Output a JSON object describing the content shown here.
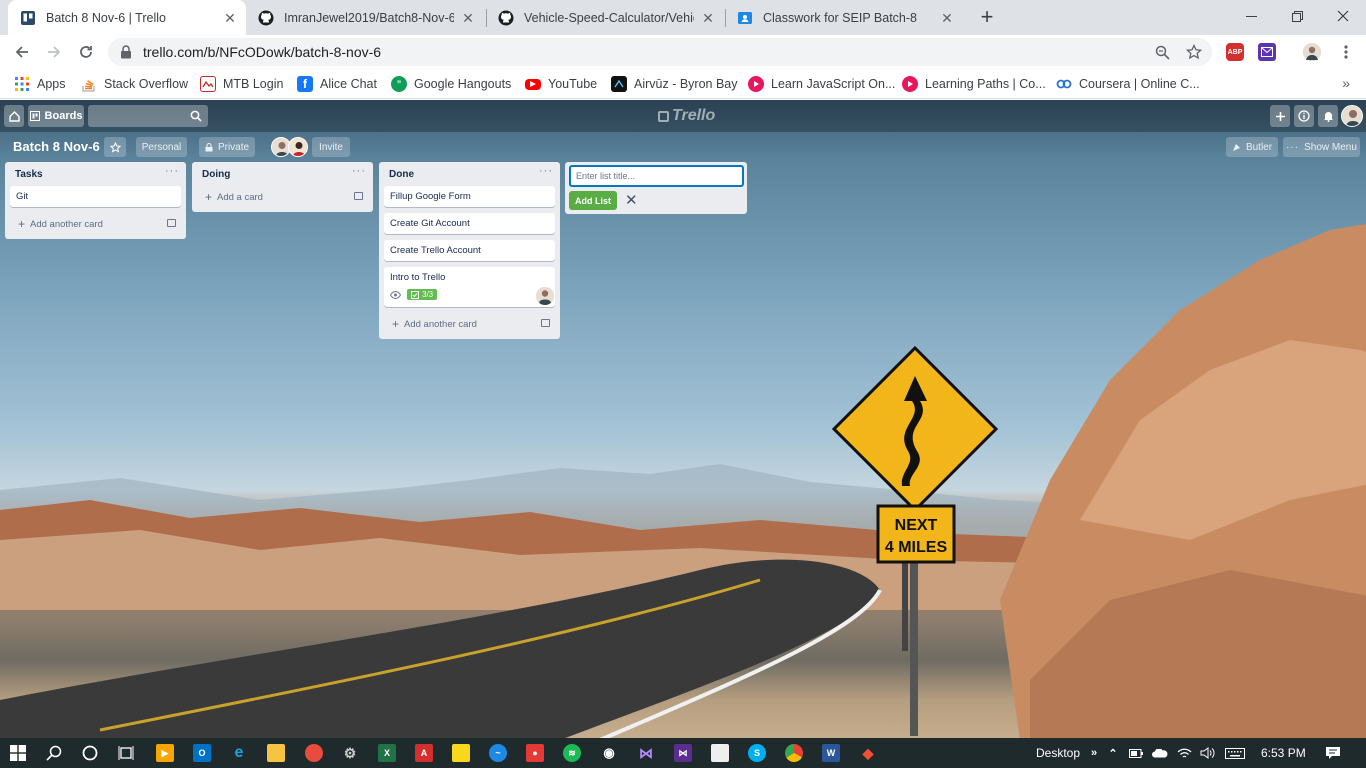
{
  "browser": {
    "tabs": [
      {
        "title": "Batch 8 Nov-6 | Trello",
        "icon": "trello-icon",
        "active": true
      },
      {
        "title": "ImranJewel2019/Batch8-Nov-6",
        "icon": "github-icon",
        "active": false
      },
      {
        "title": "Vehicle-Speed-Calculator/Vehicle",
        "icon": "github-icon",
        "active": false
      },
      {
        "title": "Classwork for SEIP Batch-8",
        "icon": "classroom-icon",
        "active": false
      }
    ],
    "url": "trello.com/b/NFcODowk/batch-8-nov-6",
    "extensions": {
      "abp": "ABP"
    }
  },
  "bookmarks": [
    {
      "label": "Apps",
      "icon": "apps-grid-icon",
      "color": "#4285f4"
    },
    {
      "label": "Stack Overflow",
      "icon": "stackoverflow-icon",
      "color": "#f48024"
    },
    {
      "label": "MTB Login",
      "icon": "mtb-icon",
      "color": "#c62828"
    },
    {
      "label": "Alice Chat",
      "icon": "facebook-icon",
      "color": "#1877f2"
    },
    {
      "label": "Google Hangouts",
      "icon": "hangouts-icon",
      "color": "#0f9d58"
    },
    {
      "label": "YouTube",
      "icon": "youtube-icon",
      "color": "#ff0000"
    },
    {
      "label": "Airvūz - Byron Bay",
      "icon": "airvuz-icon",
      "color": "#111111"
    },
    {
      "label": "Learn JavaScript On...",
      "icon": "scrimba-icon",
      "color": "#e8175d"
    },
    {
      "label": "Learning Paths | Co...",
      "icon": "scrimba-icon",
      "color": "#e8175d"
    },
    {
      "label": "Coursera | Online C...",
      "icon": "coursera-icon",
      "color": "#2a73cc"
    }
  ],
  "trello": {
    "header": {
      "boards_label": "Boards",
      "logo_text": "Trello"
    },
    "board": {
      "title": "Batch 8 Nov-6",
      "visibility_team": "Personal",
      "visibility": "Private",
      "invite_label": "Invite",
      "butler_label": "Butler",
      "show_menu_label": "Show Menu"
    },
    "lists": [
      {
        "title": "Tasks",
        "cards": [
          {
            "title": "Git"
          }
        ],
        "add_label": "Add another card"
      },
      {
        "title": "Doing",
        "cards": [],
        "add_label": "Add a card"
      },
      {
        "title": "Done",
        "cards": [
          {
            "title": "Fillup Google Form"
          },
          {
            "title": "Create Git Account"
          },
          {
            "title": "Create Trello Account"
          },
          {
            "title": "Intro to Trello",
            "checklist": "3/3"
          }
        ],
        "add_label": "Add another card"
      }
    ],
    "add_list": {
      "placeholder": "Enter list title...",
      "button_label": "Add List"
    }
  },
  "background": {
    "sign_line1": "NEXT",
    "sign_line2": "4 MILES"
  },
  "taskbar": {
    "desktop_label": "Desktop",
    "time": "6:53 PM"
  }
}
